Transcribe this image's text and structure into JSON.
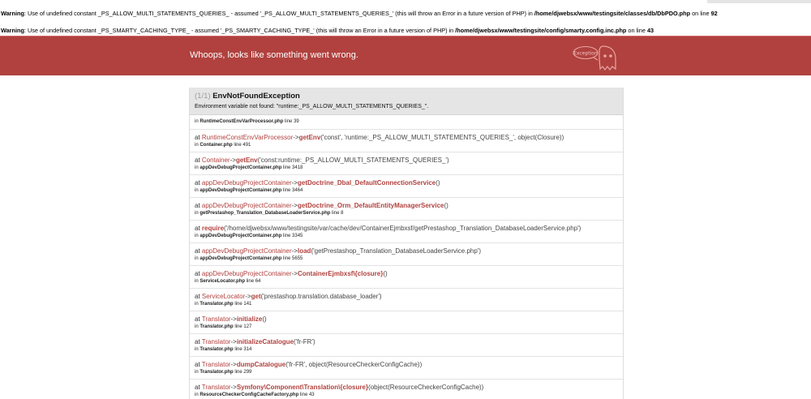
{
  "warnings": [
    {
      "label": "Warning",
      "text": ": Use of undefined constant _PS_ALLOW_MULTI_STATEMENTS_QUERIES_ - assumed '_PS_ALLOW_MULTI_STATEMENTS_QUERIES_' (this will throw an Error in a future version of PHP) in ",
      "file": "/home/djwebsx/www/testingsite/classes/db/DbPDO.php",
      "on_line": " on line ",
      "line": "92"
    },
    {
      "label": "Warning",
      "text": ": Use of undefined constant _PS_SMARTY_CACHING_TYPE_ - assumed '_PS_SMARTY_CACHING_TYPE_' (this will throw an Error in a future version of PHP) in ",
      "file": "/home/djwebsx/www/testingsite/config/smarty.config.inc.php",
      "on_line": " on line ",
      "line": "43"
    }
  ],
  "banner": {
    "message": "Whoops, looks like something went wrong.",
    "ghost_label": "Exception",
    "color": "#b0413e"
  },
  "exception": {
    "counter": "(1/1)",
    "class": "EnvNotFoundException",
    "message": "Environment variable not found: \"runtime:_PS_ALLOW_MULTI_STATEMENTS_QUERIES_\"."
  },
  "trace": [
    {
      "in": "in",
      "file": "RuntimeConstEnvVarProcessor.php",
      "line_word": "line",
      "line": "39"
    },
    {
      "at": "at",
      "cls": "RuntimeConstEnvVarProcessor",
      "arrow": "->",
      "method": "getEnv",
      "args": "('const', 'runtime:_PS_ALLOW_MULTI_STATEMENTS_QUERIES_', object(Closure))",
      "in": "in",
      "file": "Container.php",
      "line_word": "line",
      "line": "491"
    },
    {
      "at": "at",
      "cls": "Container",
      "arrow": "->",
      "method": "getEnv",
      "args": "('const:runtime:_PS_ALLOW_MULTI_STATEMENTS_QUERIES_')",
      "in": "in",
      "file": "appDevDebugProjectContainer.php",
      "line_word": "line",
      "line": "3418"
    },
    {
      "at": "at",
      "cls": "appDevDebugProjectContainer",
      "arrow": "->",
      "method": "getDoctrine_Dbal_DefaultConnectionService",
      "args": "()",
      "in": "in",
      "file": "appDevDebugProjectContainer.php",
      "line_word": "line",
      "line": "3464"
    },
    {
      "at": "at",
      "cls": "appDevDebugProjectContainer",
      "arrow": "->",
      "method": "getDoctrine_Orm_DefaultEntityManagerService",
      "args": "()",
      "in": "in",
      "file": "getPrestashop_Translation_DatabaseLoaderService.php",
      "line_word": "line",
      "line": "8"
    },
    {
      "at": "at",
      "cls": "",
      "arrow": "",
      "method": "require",
      "args": "('/home/djwebsx/www/testingsite/var/cache/dev/ContainerEjmbxsf/getPrestashop_Translation_DatabaseLoaderService.php')",
      "in": "in",
      "file": "appDevDebugProjectContainer.php",
      "line_word": "line",
      "line": "3345"
    },
    {
      "at": "at",
      "cls": "appDevDebugProjectContainer",
      "arrow": "->",
      "method": "load",
      "args": "('getPrestashop_Translation_DatabaseLoaderService.php')",
      "in": "in",
      "file": "appDevDebugProjectContainer.php",
      "line_word": "line",
      "line": "5655"
    },
    {
      "at": "at",
      "cls": "appDevDebugProjectContainer",
      "arrow": "->",
      "method": "ContainerEjmbxsf\\{closure}",
      "args": "()",
      "in": "in",
      "file": "ServiceLocator.php",
      "line_word": "line",
      "line": "64"
    },
    {
      "at": "at",
      "cls": "ServiceLocator",
      "arrow": "->",
      "method": "get",
      "args": "('prestashop.translation.database_loader')",
      "in": "in",
      "file": "Translator.php",
      "line_word": "line",
      "line": "141"
    },
    {
      "at": "at",
      "cls": "Translator",
      "arrow": "->",
      "method": "initialize",
      "args": "()",
      "in": "in",
      "file": "Translator.php",
      "line_word": "line",
      "line": "127"
    },
    {
      "at": "at",
      "cls": "Translator",
      "arrow": "->",
      "method": "initializeCatalogue",
      "args": "('fr-FR')",
      "in": "in",
      "file": "Translator.php",
      "line_word": "line",
      "line": "314"
    },
    {
      "at": "at",
      "cls": "Translator",
      "arrow": "->",
      "method": "dumpCatalogue",
      "args": "('fr-FR', object(ResourceCheckerConfigCache))",
      "in": "in",
      "file": "Translator.php",
      "line_word": "line",
      "line": "299"
    },
    {
      "at": "at",
      "cls": "Translator",
      "arrow": "->",
      "method": "Symfony\\Component\\Translation\\{closure}",
      "args": "(object(ResourceCheckerConfigCache))",
      "in": "in",
      "file": "ResourceCheckerConfigCacheFactory.php",
      "line_word": "line",
      "line": "43"
    }
  ]
}
